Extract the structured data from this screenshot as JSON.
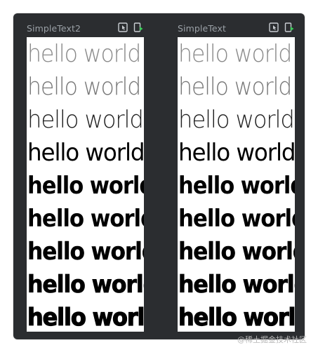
{
  "panels": [
    {
      "title": "SimpleText2",
      "icons": [
        "interactive-preview-icon",
        "deploy-to-device-icon"
      ],
      "lines": [
        "hello world",
        "hello world",
        "hello world",
        "hello world",
        "hello world",
        "hello world",
        "hello world",
        "hello world",
        "hello world"
      ]
    },
    {
      "title": "SimpleText",
      "icons": [
        "interactive-preview-icon",
        "deploy-to-device-icon"
      ],
      "lines": [
        "hello world",
        "hello world",
        "hello world",
        "hello world",
        "hello world",
        "hello world",
        "hello world",
        "hello world",
        "hello world"
      ]
    }
  ],
  "watermark": "@稀土掘金技术社区",
  "colors": {
    "frame_bg": "#2b2d30",
    "title_text": "#9aa0a6",
    "icon_green": "#3ccf5b",
    "canvas_bg": "#ffffff"
  }
}
